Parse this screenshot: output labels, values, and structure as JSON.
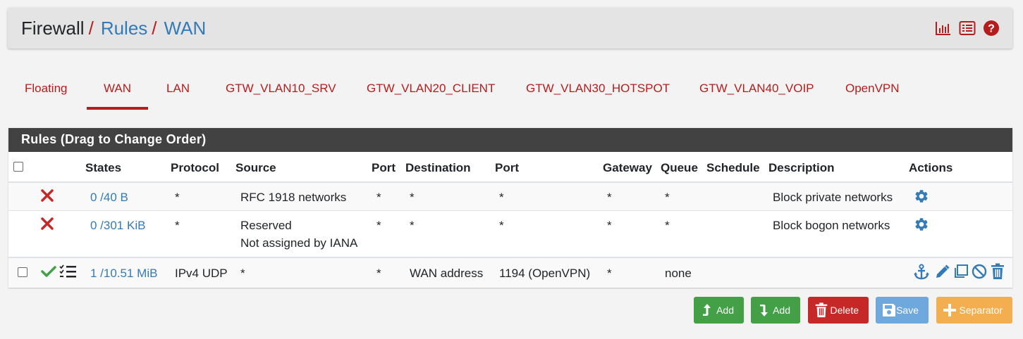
{
  "header": {
    "breadcrumb": {
      "root": "Firewall",
      "sep": "/",
      "level2": "Rules",
      "level3": "WAN"
    },
    "icons": [
      "chart-icon",
      "list-icon",
      "help-icon"
    ]
  },
  "tabs": [
    {
      "label": "Floating",
      "active": false
    },
    {
      "label": "WAN",
      "active": true
    },
    {
      "label": "LAN",
      "active": false
    },
    {
      "label": "GTW_VLAN10_SRV",
      "active": false
    },
    {
      "label": "GTW_VLAN20_CLIENT",
      "active": false
    },
    {
      "label": "GTW_VLAN30_HOTSPOT",
      "active": false
    },
    {
      "label": "GTW_VLAN40_VOIP",
      "active": false
    },
    {
      "label": "OpenVPN",
      "active": false
    }
  ],
  "panel": {
    "title": "Rules (Drag to Change Order)",
    "columns": [
      "States",
      "Protocol",
      "Source",
      "Port",
      "Destination",
      "Port",
      "Gateway",
      "Queue",
      "Schedule",
      "Description",
      "Actions"
    ],
    "rows": [
      {
        "action": "block",
        "states": "0 /40 B",
        "protocol": "*",
        "source": "RFC 1918 networks",
        "source_line2": "",
        "src_port": "*",
        "destination": "*",
        "dst_port": "*",
        "gateway": "*",
        "queue": "*",
        "schedule": "",
        "description": "Block private networks"
      },
      {
        "action": "block",
        "states": "0 /301 KiB",
        "protocol": "*",
        "source": "Reserved",
        "source_line2": "Not assigned by IANA",
        "src_port": "*",
        "destination": "*",
        "dst_port": "*",
        "gateway": "*",
        "queue": "*",
        "schedule": "",
        "description": "Block bogon networks"
      },
      {
        "action": "pass",
        "states": "1 /10.51 MiB",
        "protocol": "IPv4 UDP",
        "source": "*",
        "source_line2": "",
        "src_port": "*",
        "destination": "WAN address",
        "dst_port": "1194 (OpenVPN)",
        "gateway": "*",
        "queue": "none",
        "schedule": "",
        "description": ""
      }
    ]
  },
  "buttons": {
    "add_top": "Add",
    "add_bottom": "Add",
    "delete": "Delete",
    "save": "Save",
    "separator": "Separator"
  },
  "colors": {
    "accent_red": "#b71c1c",
    "link_blue": "#337ab7",
    "pass_green": "#43a047",
    "btn_green": "#43a047",
    "btn_red": "#c62828",
    "btn_blue": "#6fa8dc",
    "btn_orange": "#f2ae4f"
  }
}
